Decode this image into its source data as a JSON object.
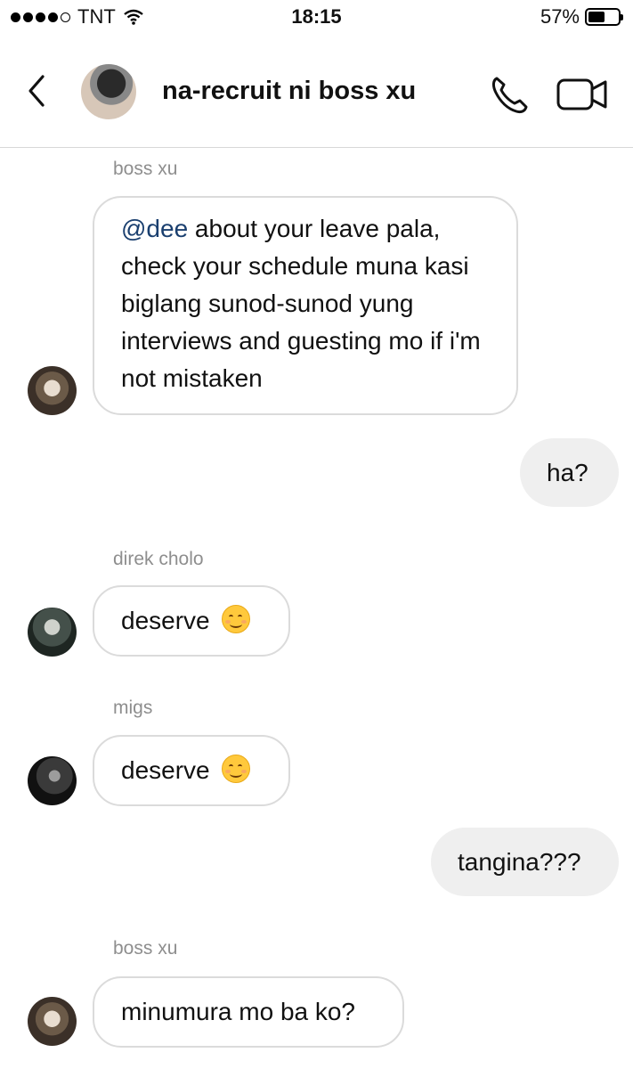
{
  "status_bar": {
    "carrier": "TNT",
    "time": "18:15",
    "battery_percent": "57%",
    "battery_level": 0.57,
    "signal_bars": 4,
    "icons": [
      "signal-dots-icon",
      "wifi-icon",
      "battery-icon"
    ]
  },
  "header": {
    "title": "na-recruit ni boss xu",
    "icons": [
      "back-chevron-icon",
      "group-avatar",
      "phone-icon",
      "video-camera-icon"
    ]
  },
  "messages": [
    {
      "sender": "boss xu",
      "mention": "@dee",
      "text": " about your leave pala, check your schedule muna kasi biglang sunod-sunod yung interviews and guesting mo if i'm not mistaken"
    },
    {
      "outgoing": true,
      "text": "ha?"
    },
    {
      "sender": "direk cholo",
      "text": "deserve"
    },
    {
      "sender": "migs",
      "text": "deserve"
    },
    {
      "outgoing": true,
      "text": "tangina???"
    },
    {
      "sender": "boss xu",
      "text": "minumura mo ba ko?"
    }
  ],
  "colors": {
    "mention": "#1a3f6f",
    "outgoing_bubble": "#efefef",
    "incoming_border": "#dbdbdb",
    "sender_label": "#8e8e8e"
  }
}
